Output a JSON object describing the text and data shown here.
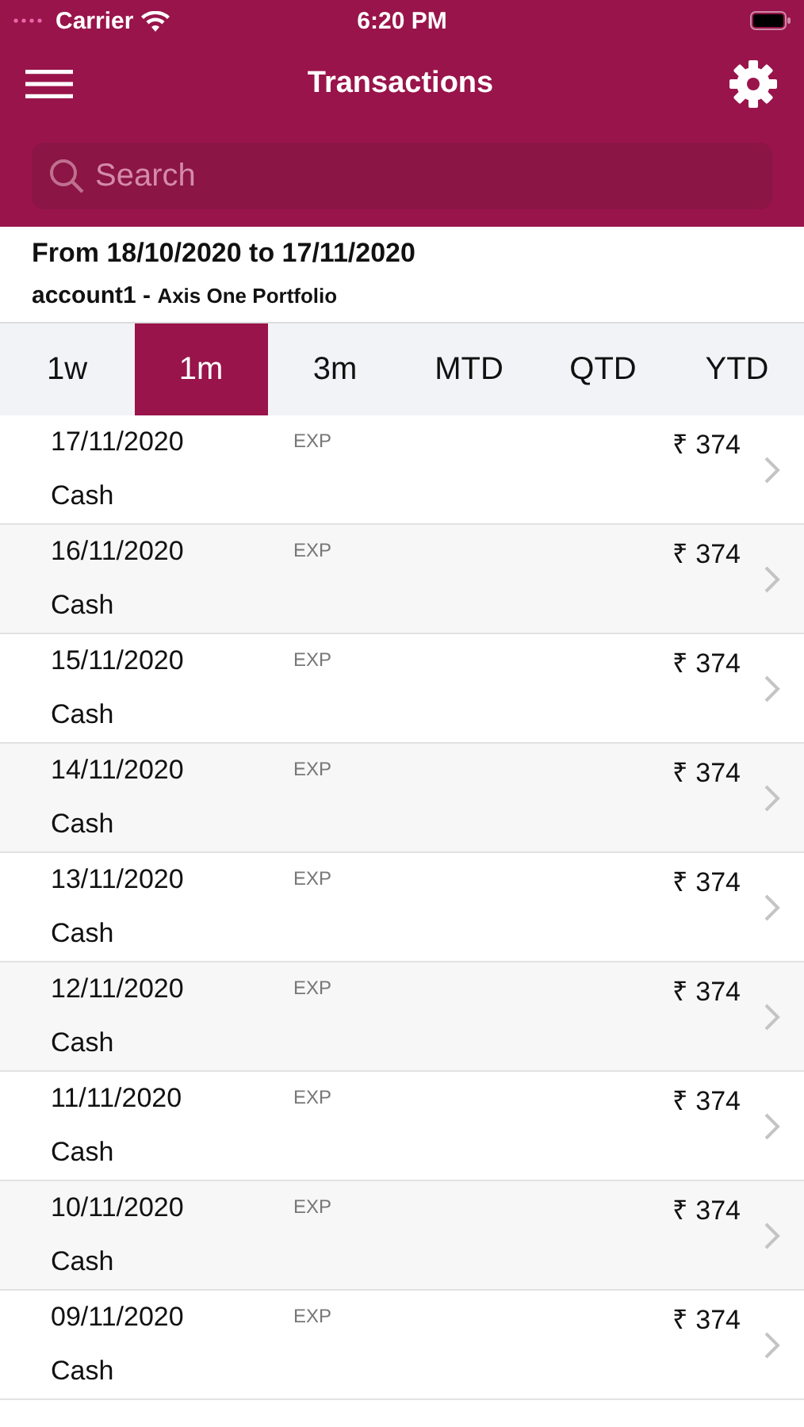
{
  "status_bar": {
    "carrier": "Carrier",
    "time": "6:20 PM"
  },
  "nav": {
    "title": "Transactions"
  },
  "search": {
    "placeholder": "Search"
  },
  "summary": {
    "range": "From 18/10/2020 to 17/11/2020",
    "account": "account1 - ",
    "portfolio": "Axis One Portfolio"
  },
  "tabs": [
    {
      "label": "1w",
      "selected": false
    },
    {
      "label": "1m",
      "selected": true
    },
    {
      "label": "3m",
      "selected": false
    },
    {
      "label": "MTD",
      "selected": false
    },
    {
      "label": "QTD",
      "selected": false
    },
    {
      "label": "YTD",
      "selected": false
    }
  ],
  "transactions": [
    {
      "date": "17/11/2020",
      "type": "EXP",
      "amount": "₹ 374",
      "method": "Cash"
    },
    {
      "date": "16/11/2020",
      "type": "EXP",
      "amount": "₹ 374",
      "method": "Cash"
    },
    {
      "date": "15/11/2020",
      "type": "EXP",
      "amount": "₹ 374",
      "method": "Cash"
    },
    {
      "date": "14/11/2020",
      "type": "EXP",
      "amount": "₹ 374",
      "method": "Cash"
    },
    {
      "date": "13/11/2020",
      "type": "EXP",
      "amount": "₹ 374",
      "method": "Cash"
    },
    {
      "date": "12/11/2020",
      "type": "EXP",
      "amount": "₹ 374",
      "method": "Cash"
    },
    {
      "date": "11/11/2020",
      "type": "EXP",
      "amount": "₹ 374",
      "method": "Cash"
    },
    {
      "date": "10/11/2020",
      "type": "EXP",
      "amount": "₹ 374",
      "method": "Cash"
    },
    {
      "date": "09/11/2020",
      "type": "EXP",
      "amount": "₹ 374",
      "method": "Cash"
    }
  ]
}
